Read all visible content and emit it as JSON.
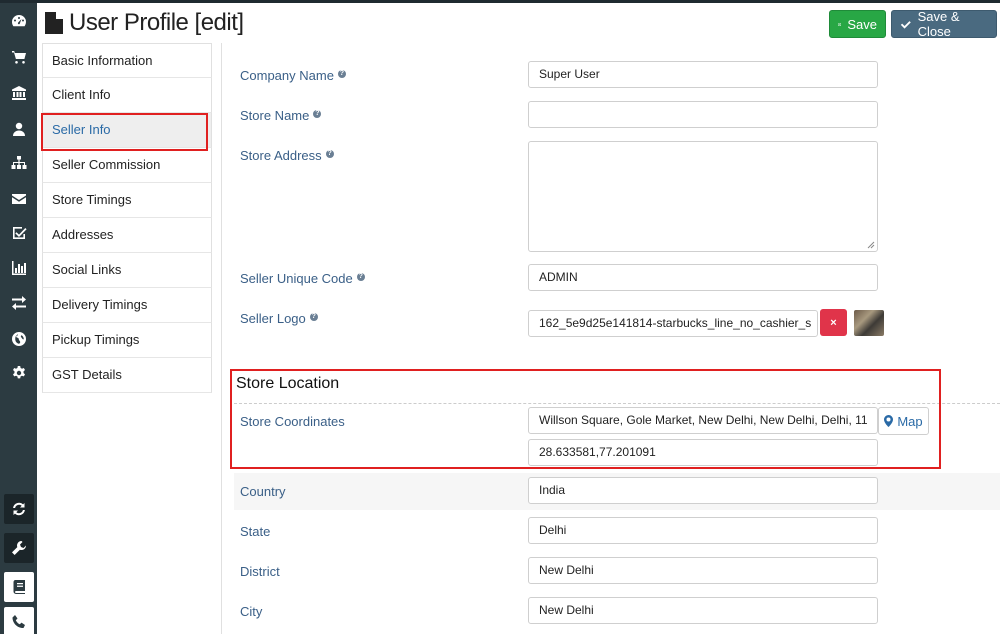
{
  "header": {
    "title": "User Profile [edit]",
    "save_label": "Save",
    "save_close_label": "Save & Close"
  },
  "sidebar_icons": [
    "dashboard-icon",
    "cart-icon",
    "bank-icon",
    "user-icon",
    "sitemap-icon",
    "envelope-icon",
    "checkbox-icon",
    "bar-chart-icon",
    "exchange-icon",
    "globe-icon",
    "gear-icon",
    "refresh-icon",
    "wrench-icon",
    "book-icon",
    "phone-icon"
  ],
  "tabs": [
    {
      "label": "Basic Information"
    },
    {
      "label": "Client Info"
    },
    {
      "label": "Seller Info",
      "active": true
    },
    {
      "label": "Seller Commission"
    },
    {
      "label": "Store Timings"
    },
    {
      "label": "Addresses"
    },
    {
      "label": "Social Links"
    },
    {
      "label": "Delivery Timings"
    },
    {
      "label": "Pickup Timings"
    },
    {
      "label": "GST Details"
    }
  ],
  "form": {
    "company_name": {
      "label": "Company Name",
      "value": "Super User"
    },
    "store_name": {
      "label": "Store Name",
      "value": ""
    },
    "store_address": {
      "label": "Store Address",
      "value": ""
    },
    "seller_unique_code": {
      "label": "Seller Unique Code",
      "value": "ADMIN"
    },
    "seller_logo": {
      "label": "Seller Logo",
      "value": "162_5e9d25e141814-starbucks_line_no_cashier_s",
      "delete_label": "×"
    },
    "store_location": {
      "title": "Store Location",
      "coordinates_label": "Store Coordinates",
      "address_value": "Willson Square, Gole Market, New Delhi, New Delhi, Delhi, 11",
      "latlng_value": "28.633581,77.201091",
      "map_label": "Map"
    },
    "country": {
      "label": "Country",
      "value": "India"
    },
    "state": {
      "label": "State",
      "value": "Delhi"
    },
    "district": {
      "label": "District",
      "value": "New Delhi"
    },
    "city": {
      "label": "City",
      "value": "New Delhi"
    }
  },
  "colors": {
    "sidebar_bg": "#2c3b41",
    "save_green": "#28a745",
    "save_close_blue": "#4a6a80",
    "label_blue": "#3a5f87",
    "highlight_red": "#e02020",
    "delete_red": "#e0344a"
  }
}
